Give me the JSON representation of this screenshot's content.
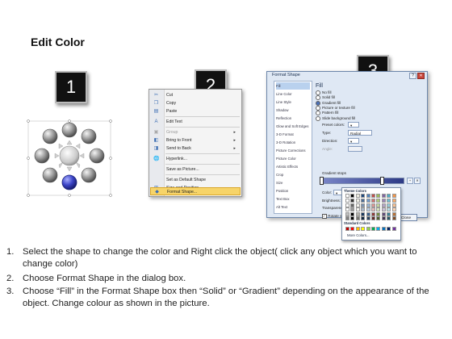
{
  "title": "Edit Color",
  "badges": [
    "1",
    "2",
    "3"
  ],
  "colors": {
    "background": "#ffffff",
    "badge": "#111111",
    "highlight": "#f7d469",
    "selected_ball": "#3c45c8",
    "gradient_start": "#7a86c8",
    "gradient_end": "#2d3a86"
  },
  "context_menu": {
    "items": [
      {
        "label": "Cut",
        "icon": "scissors-icon",
        "disabled": false,
        "submenu": false
      },
      {
        "label": "Copy",
        "icon": "copy-icon",
        "disabled": false,
        "submenu": false
      },
      {
        "label": "Paste",
        "icon": "paste-icon",
        "disabled": false,
        "submenu": false
      },
      {
        "label": "Edit Text",
        "icon": "edit-text-icon",
        "disabled": false,
        "submenu": false
      },
      {
        "label": "Group",
        "icon": "group-icon",
        "disabled": true,
        "submenu": true
      },
      {
        "label": "Bring to Front",
        "icon": "bring-front-icon",
        "disabled": false,
        "submenu": true
      },
      {
        "label": "Send to Back",
        "icon": "send-back-icon",
        "disabled": false,
        "submenu": true
      },
      {
        "label": "Hyperlink...",
        "icon": "hyperlink-icon",
        "disabled": false,
        "submenu": false
      },
      {
        "label": "Save as Picture...",
        "icon": "",
        "disabled": false,
        "submenu": false
      },
      {
        "label": "Set as Default Shape",
        "icon": "",
        "disabled": false,
        "submenu": false
      },
      {
        "label": "Size and Position...",
        "icon": "size-icon",
        "disabled": false,
        "submenu": false
      },
      {
        "label": "Format Shape...",
        "icon": "format-shape-icon",
        "disabled": false,
        "submenu": false
      }
    ]
  },
  "dialog": {
    "title": "Format Shape",
    "help_glyph": "?",
    "close_glyph": "✕",
    "categories": [
      "Fill",
      "Line Color",
      "Line Style",
      "Shadow",
      "Reflection",
      "Glow and Soft Edges",
      "3-D Format",
      "3-D Rotation",
      "Picture Corrections",
      "Picture Color",
      "Artistic Effects",
      "Crop",
      "Size",
      "Position",
      "Text Box",
      "Alt Text"
    ],
    "selected_category": "Fill",
    "fill_heading": "Fill",
    "fill_options": [
      {
        "label": "No fill",
        "selected": false
      },
      {
        "label": "Solid fill",
        "selected": false
      },
      {
        "label": "Gradient fill",
        "selected": true
      },
      {
        "label": "Picture or texture fill",
        "selected": false
      },
      {
        "label": "Pattern fill",
        "selected": false
      },
      {
        "label": "Slide background fill",
        "selected": false
      }
    ],
    "preset_label": "Preset colors:",
    "type_label": "Type:",
    "type_value": "Radial",
    "direction_label": "Direction:",
    "angle_label": "Angle:",
    "stops_label": "Gradient stops",
    "color_label": "Color:",
    "position_label": "Position:",
    "position_value": "0%",
    "brightness_label": "Brightness:",
    "transparency_label": "Transparency:",
    "rotate_label": "Rotate with shape",
    "close_label": "Close"
  },
  "palette": {
    "theme_title": "Theme Colors",
    "standard_title": "Standard Colors",
    "more_label": "More Colors...",
    "theme_top": [
      "#ffffff",
      "#000000",
      "#eeece1",
      "#1f497d",
      "#4f81bd",
      "#c0504d",
      "#9bbb59",
      "#8064a2",
      "#4bacc6",
      "#f79646"
    ],
    "standard": [
      "#c00000",
      "#ff0000",
      "#ffc000",
      "#ffff00",
      "#92d050",
      "#00b050",
      "#00b0f0",
      "#0070c0",
      "#002060",
      "#7030a0"
    ]
  },
  "steps": [
    {
      "num": "1.",
      "text": "Select the shape to change the color and Right click the object( click any object which you want to change color)"
    },
    {
      "num": "2.",
      "text": "Choose Format Shape in the dialog box."
    },
    {
      "num": "3.",
      "text": "Choose “Fill” in the Format Shape box then “Solid” or “Gradient” depending on the appearance of the object. Change colour as shown in the picture."
    }
  ]
}
